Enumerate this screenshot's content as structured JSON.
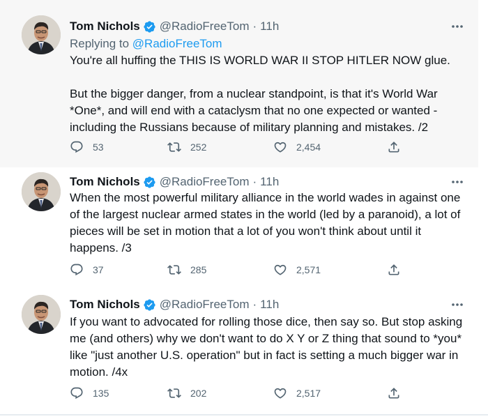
{
  "author": {
    "name": "Tom Nichols",
    "handle": "@RadioFreeTom"
  },
  "tweets": [
    {
      "time": "11h",
      "replying_prefix": "Replying to",
      "replying_handle": "@RadioFreeTom",
      "lines": [
        "You're all huffing the THIS IS WORLD WAR II STOP HITLER NOW glue.",
        "",
        "But the bigger danger, from a nuclear standpoint, is that it's World War",
        "*One*, and will end with a cataclysm that no one expected or wanted -",
        "including the Russians because of military planning and mistakes. /2"
      ],
      "replies": "53",
      "retweets": "252",
      "likes": "2,454"
    },
    {
      "time": "11h",
      "lines": [
        "When the most powerful military alliance in the world wades in against one",
        "of the largest nuclear armed states in the world (led by a paranoid), a lot of",
        "pieces will be set in motion that a lot of you won't think about until it",
        "happens. /3"
      ],
      "replies": "37",
      "retweets": "285",
      "likes": "2,571"
    },
    {
      "time": "11h",
      "lines": [
        "If you want to advocated for rolling those dice, then say so. But stop asking",
        "me (and others) why we don't want to do X Y or Z thing that sound to *you*",
        "like \"just another U.S. operation\" but in fact is setting a much bigger war in",
        "motion. /4x"
      ],
      "replies": "135",
      "retweets": "202",
      "likes": "2,517"
    }
  ],
  "separator": "·",
  "icons": {
    "verified": "verified-badge-icon",
    "more": "more-options-icon",
    "reply": "reply-icon",
    "retweet": "retweet-icon",
    "like": "like-icon",
    "share": "share-icon"
  },
  "colors": {
    "accent": "#1d9bf0",
    "secondary_text": "#536471",
    "highlight_bg": "#f7f7f7"
  }
}
